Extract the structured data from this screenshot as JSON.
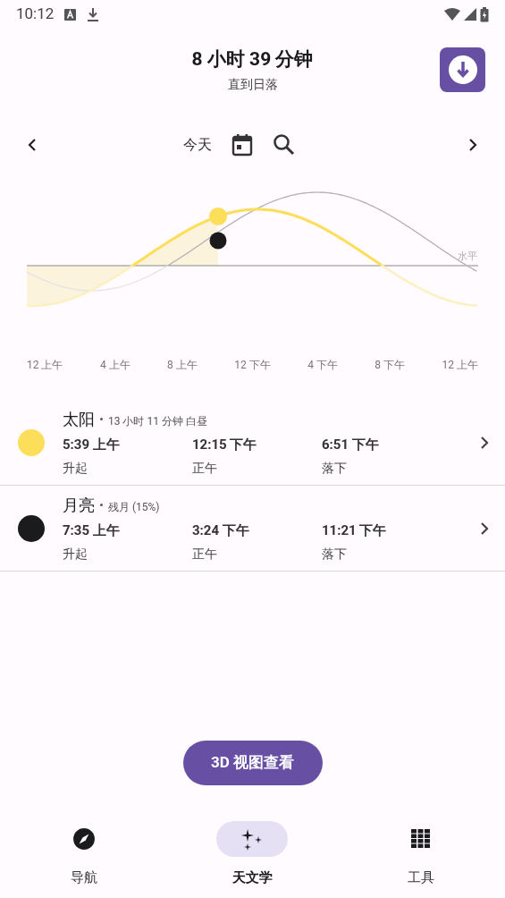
{
  "status_bar": {
    "time": "10:12"
  },
  "header": {
    "title": "8 小时 39 分钟",
    "subtitle": "直到日落"
  },
  "date_nav": {
    "label": "今天"
  },
  "chart": {
    "horizon_label": "水平",
    "time_labels": [
      "12 上午",
      "4 上午",
      "8 上午",
      "12 下午",
      "4 下午",
      "8 下午",
      "12 上午"
    ]
  },
  "bodies": [
    {
      "name": "太阳",
      "detail": "13 小时 11 分钟 白昼",
      "color": "#fdde5a",
      "events": [
        {
          "time": "5:39 上午",
          "label": "升起"
        },
        {
          "time": "12:15 下午",
          "label": "正午"
        },
        {
          "time": "6:51 下午",
          "label": "落下"
        }
      ]
    },
    {
      "name": "月亮",
      "detail": "残月 (15%)",
      "color": "#1b1b1b",
      "events": [
        {
          "time": "7:35 上午",
          "label": "升起"
        },
        {
          "time": "3:24 下午",
          "label": "正午"
        },
        {
          "time": "11:21 下午",
          "label": "落下"
        }
      ]
    }
  ],
  "view_button": "3D 视图查看",
  "bottom_nav": [
    {
      "kind": "compass",
      "label": "导航",
      "selected": false
    },
    {
      "kind": "stars",
      "label": "天文学",
      "selected": true
    },
    {
      "kind": "grid",
      "label": "工具",
      "selected": false
    }
  ]
}
